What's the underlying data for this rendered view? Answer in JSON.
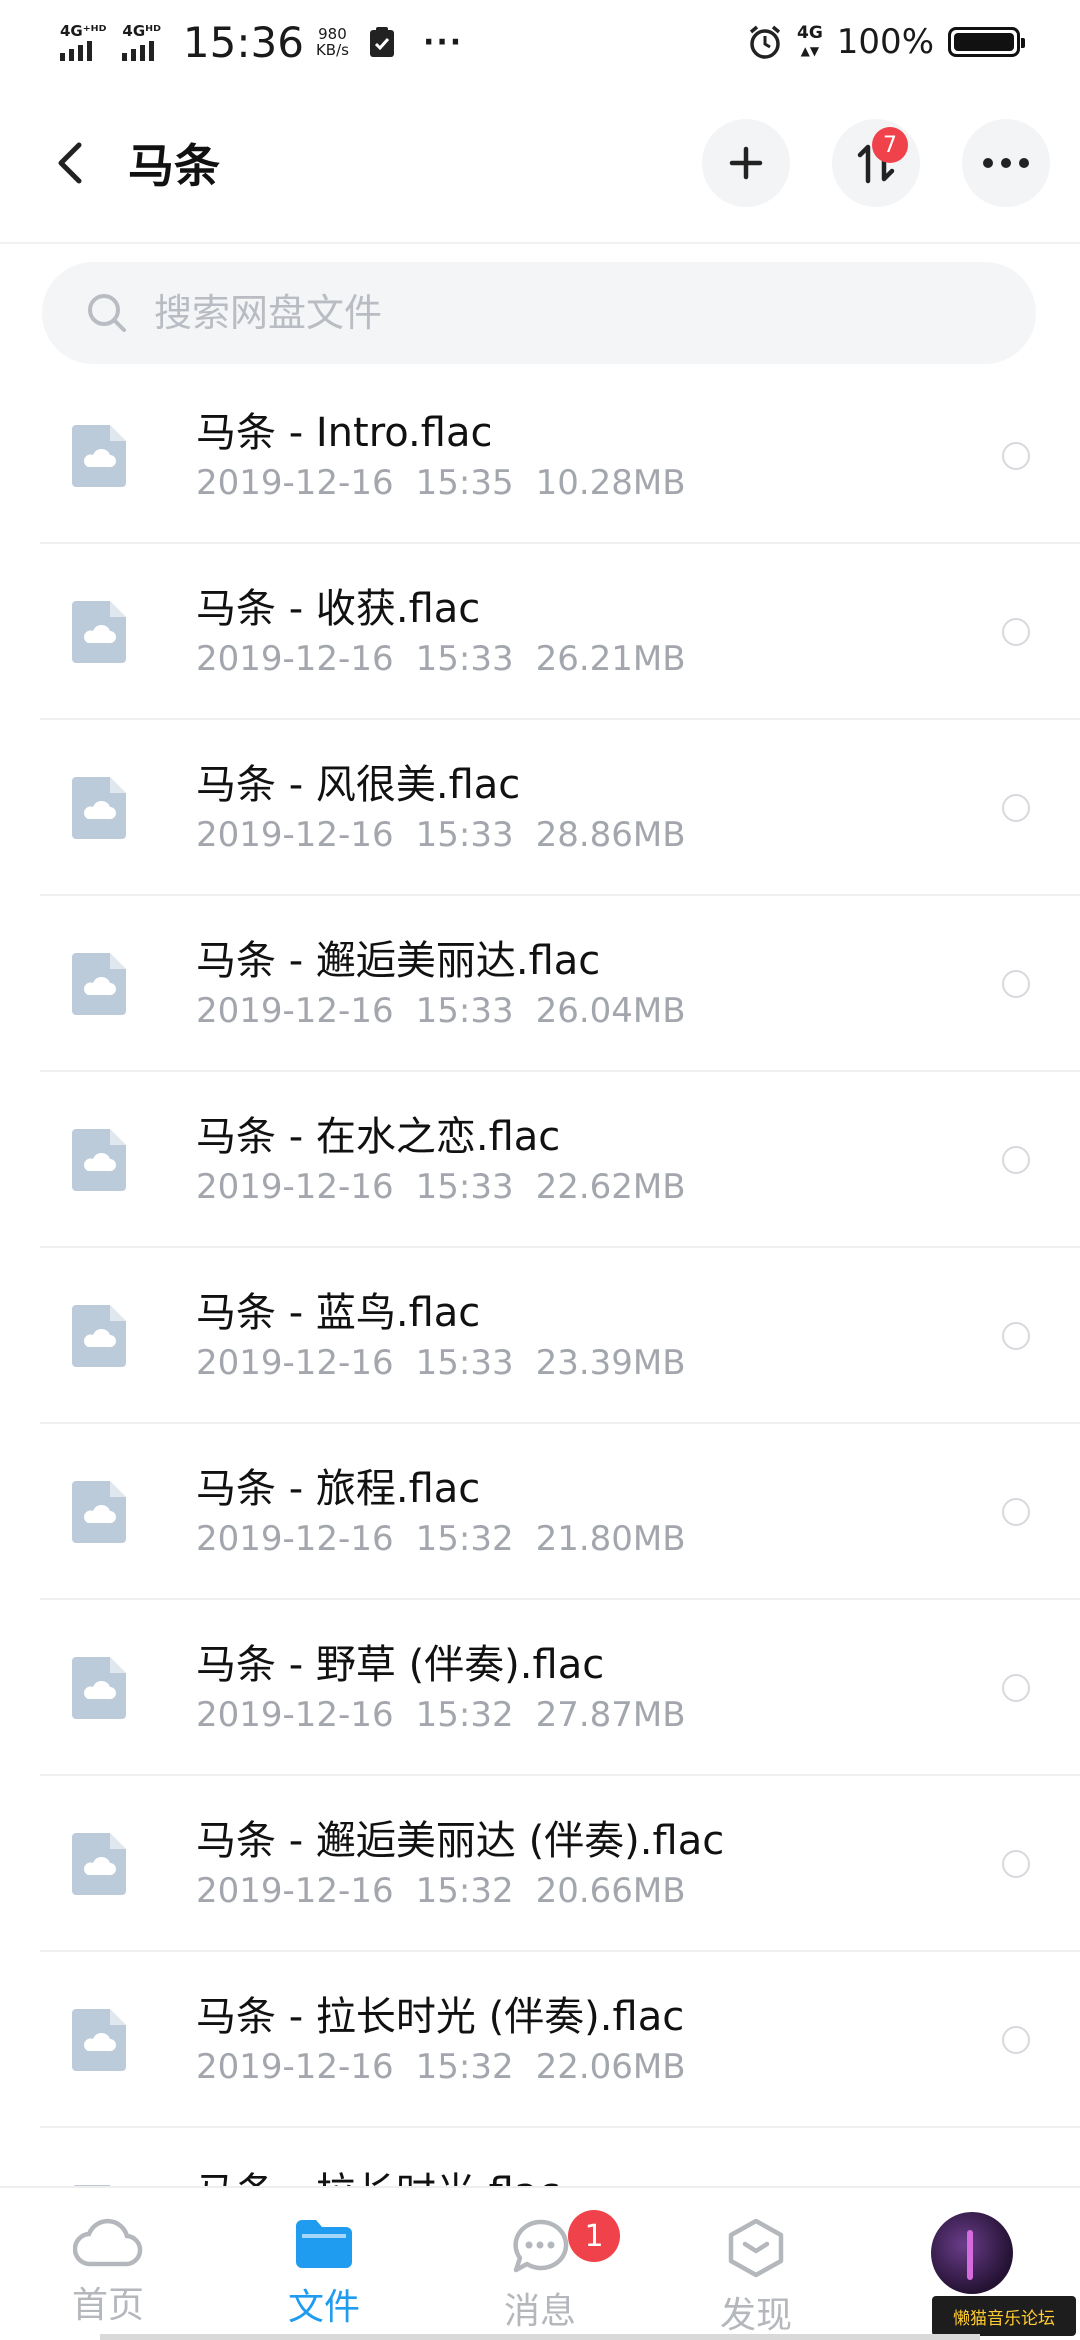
{
  "status_bar": {
    "sim1_label": "4G⁺ᴴᴰ",
    "sim2_label": "4Gᴴᴰ",
    "time": "15:36",
    "speed_value": "980",
    "speed_unit": "KB/s",
    "more": "···",
    "net_label": "4G",
    "battery_percent": "100%"
  },
  "header": {
    "title": "马条",
    "transfer_badge": "7"
  },
  "search": {
    "placeholder": "搜索网盘文件"
  },
  "files": [
    {
      "name": "马条 - Intro.flac",
      "date": "2019-12-16",
      "time": "15:35",
      "size": "10.28MB"
    },
    {
      "name": "马条 - 收获.flac",
      "date": "2019-12-16",
      "time": "15:33",
      "size": "26.21MB"
    },
    {
      "name": "马条 - 风很美.flac",
      "date": "2019-12-16",
      "time": "15:33",
      "size": "28.86MB"
    },
    {
      "name": "马条 - 邂逅美丽达.flac",
      "date": "2019-12-16",
      "time": "15:33",
      "size": "26.04MB"
    },
    {
      "name": "马条 - 在水之恋.flac",
      "date": "2019-12-16",
      "time": "15:33",
      "size": "22.62MB"
    },
    {
      "name": "马条 - 蓝鸟.flac",
      "date": "2019-12-16",
      "time": "15:33",
      "size": "23.39MB"
    },
    {
      "name": "马条 - 旅程.flac",
      "date": "2019-12-16",
      "time": "15:32",
      "size": "21.80MB"
    },
    {
      "name": "马条 - 野草 (伴奏).flac",
      "date": "2019-12-16",
      "time": "15:32",
      "size": "27.87MB"
    },
    {
      "name": "马条 - 邂逅美丽达 (伴奏).flac",
      "date": "2019-12-16",
      "time": "15:32",
      "size": "20.66MB"
    },
    {
      "name": "马条 - 拉长时光 (伴奏).flac",
      "date": "2019-12-16",
      "time": "15:32",
      "size": "22.06MB"
    },
    {
      "name": "马条 - 拉长时光.flac",
      "date": "",
      "time": "",
      "size": ""
    }
  ],
  "nav": {
    "items": [
      {
        "label": "首页",
        "icon": "cloud-icon"
      },
      {
        "label": "文件",
        "icon": "folder-icon"
      },
      {
        "label": "消息",
        "icon": "chat-icon"
      },
      {
        "label": "发现",
        "icon": "discover-icon"
      }
    ],
    "messages_badge": "1",
    "watermark": "懒猫音乐论坛"
  },
  "colors": {
    "accent": "#1f9bf0",
    "badge": "#f0424a",
    "file_icon": "#bccbd9"
  }
}
